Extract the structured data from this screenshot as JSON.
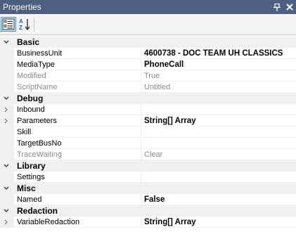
{
  "panel": {
    "title": "Properties",
    "pin_glyph": "📌",
    "close_glyph": "✕"
  },
  "toolbar": {
    "categorized_icon": "categorized-view-icon",
    "alphabetical_icon": "sort-alphabetical-icon"
  },
  "colors": {
    "titlebar": "#4d6082",
    "category_bg": "#f0f0f0",
    "readonly_text": "#8c8c8c",
    "selected_tool_border": "#3399ff"
  },
  "categories": [
    {
      "name": "Basic",
      "properties": [
        {
          "name": "BusinessUnit",
          "value": "4600738 - DOC TEAM UH CLASSICS",
          "bold": true,
          "readonly": false,
          "expandable": false
        },
        {
          "name": "MediaType",
          "value": "PhoneCall",
          "bold": true,
          "readonly": false,
          "expandable": false
        },
        {
          "name": "Modified",
          "value": "True",
          "bold": false,
          "readonly": true,
          "expandable": false
        },
        {
          "name": "ScriptName",
          "value": "Untitled",
          "bold": false,
          "readonly": true,
          "expandable": false
        }
      ]
    },
    {
      "name": "Debug",
      "properties": [
        {
          "name": "Inbound",
          "value": "",
          "bold": false,
          "readonly": false,
          "expandable": true
        },
        {
          "name": "Parameters",
          "value": "String[] Array",
          "bold": true,
          "readonly": false,
          "expandable": true
        },
        {
          "name": "Skill",
          "value": "",
          "bold": false,
          "readonly": false,
          "expandable": false
        },
        {
          "name": "TargetBusNo",
          "value": "",
          "bold": false,
          "readonly": false,
          "expandable": false
        },
        {
          "name": "TraceWaiting",
          "value": "Clear",
          "bold": false,
          "readonly": true,
          "expandable": false
        }
      ]
    },
    {
      "name": "Library",
      "properties": [
        {
          "name": "Settings",
          "value": "",
          "bold": false,
          "readonly": false,
          "expandable": false
        }
      ]
    },
    {
      "name": "Misc",
      "properties": [
        {
          "name": "Named",
          "value": "False",
          "bold": true,
          "readonly": false,
          "expandable": false
        }
      ]
    },
    {
      "name": "Redaction",
      "properties": [
        {
          "name": "VariableRedaction",
          "value": "String[] Array",
          "bold": true,
          "readonly": false,
          "expandable": true
        }
      ]
    }
  ]
}
